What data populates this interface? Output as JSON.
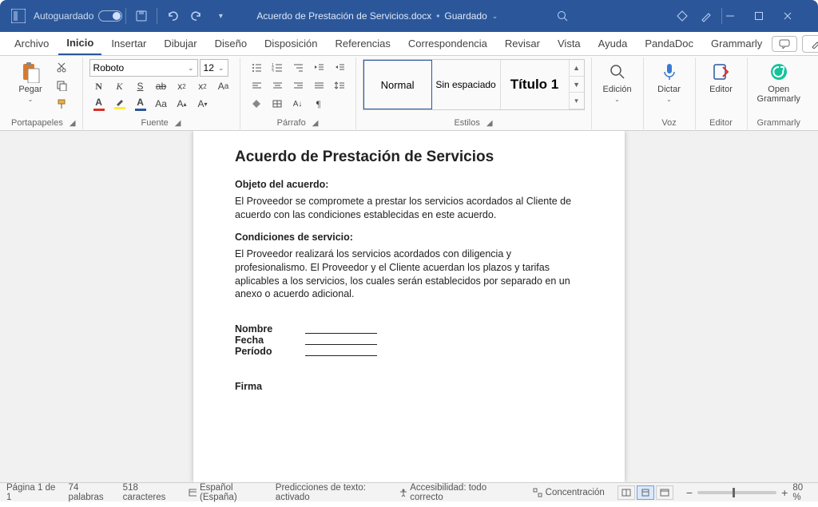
{
  "titlebar": {
    "autosave": "Autoguardado",
    "docname": "Acuerdo de Prestación de Servicios.docx",
    "saved": "Guardado"
  },
  "tabs": [
    "Archivo",
    "Inicio",
    "Insertar",
    "Dibujar",
    "Diseño",
    "Disposición",
    "Referencias",
    "Correspondencia",
    "Revisar",
    "Vista",
    "Ayuda",
    "PandaDoc",
    "Grammarly"
  ],
  "active_tab": "Inicio",
  "editbtn": "Edición",
  "groups": {
    "clipboard": {
      "label": "Portapapeles",
      "paste": "Pegar"
    },
    "font": {
      "label": "Fuente",
      "name": "Roboto",
      "size": "12"
    },
    "paragraph": {
      "label": "Párrafo"
    },
    "styles": {
      "label": "Estilos",
      "items": [
        "Normal",
        "Sin espaciado",
        "Título 1"
      ]
    },
    "edit": {
      "label": "Edición"
    },
    "voice": {
      "label": "Voz",
      "btn": "Dictar"
    },
    "editor": {
      "label": "Editor",
      "btn": "Editor"
    },
    "grammarly": {
      "label": "Grammarly",
      "btn": "Open Grammarly"
    }
  },
  "document": {
    "title": "Acuerdo de Prestación de Servicios",
    "s1_title": "Objeto del acuerdo:",
    "s1_body": "El Proveedor se compromete a prestar los servicios acordados al Cliente de acuerdo con las condiciones establecidas en este acuerdo.",
    "s2_title": "Condiciones de servicio:",
    "s2_body": "El Proveedor realizará los servicios acordados con diligencia y profesionalismo. El Proveedor y el Cliente acuerdan los plazos y tarifas aplicables a los servicios, los cuales serán establecidos por separado en un anexo o acuerdo adicional.",
    "f_name": "Nombre",
    "f_date": "Fecha",
    "f_period": "Período",
    "f_sign": "Firma"
  },
  "statusbar": {
    "page": "Página 1 de 1",
    "words": "74 palabras",
    "chars": "518 caracteres",
    "lang": "Español (España)",
    "pred": "Predicciones de texto: activado",
    "a11y": "Accesibilidad: todo correcto",
    "focus": "Concentración",
    "zoom": "80 %"
  }
}
